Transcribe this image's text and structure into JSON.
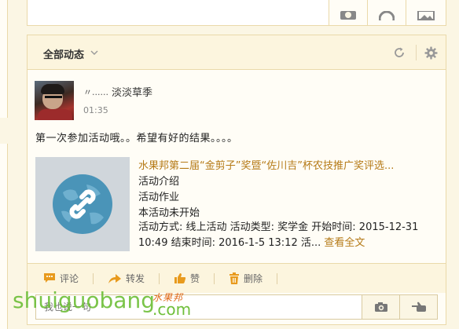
{
  "feed": {
    "filter_label": "全部动态",
    "post": {
      "username": "淡淡草季",
      "name_mark": "〃......",
      "time": "01:35",
      "text": "第一次参加活动哦。。希望有好的结果。。。。",
      "share": {
        "title": "水果邦第二届“金剪子”奖暨“佐川吉”杯农技推广奖评选...",
        "line1": "活动介绍",
        "line2": "活动作业",
        "line3": "本活动未开始",
        "meta": "活动方式: 线上活动 活动类型: 奖学金 开始时间: 2015-12-31 10:49 结束时间: 2016-1-5 13:12 活...",
        "more_label": "查看全文"
      }
    },
    "actions": {
      "comment": "评论",
      "forward": "转发",
      "like": "赞",
      "delete": "删除"
    },
    "comment_box": {
      "placeholder": "我也说一句"
    }
  },
  "watermark": {
    "text": "shuiguobang",
    "cn": "水果邦",
    "com": ".com"
  },
  "colors": {
    "accent": "#b57a17",
    "action_icon": "#e89a1d",
    "background": "#fbf6e4",
    "border": "#ead9a9"
  },
  "icons": {
    "filter": "chevron-down-icon",
    "refresh": "refresh-icon",
    "settings": "gear-icon",
    "share_thumb": "link-globe-icon",
    "comment": "speech-bubble-icon",
    "forward": "forward-arrow-icon",
    "like": "thumbs-up-icon",
    "delete": "trash-icon",
    "camera": "camera-icon",
    "emoji": "pointing-hand-icon"
  }
}
